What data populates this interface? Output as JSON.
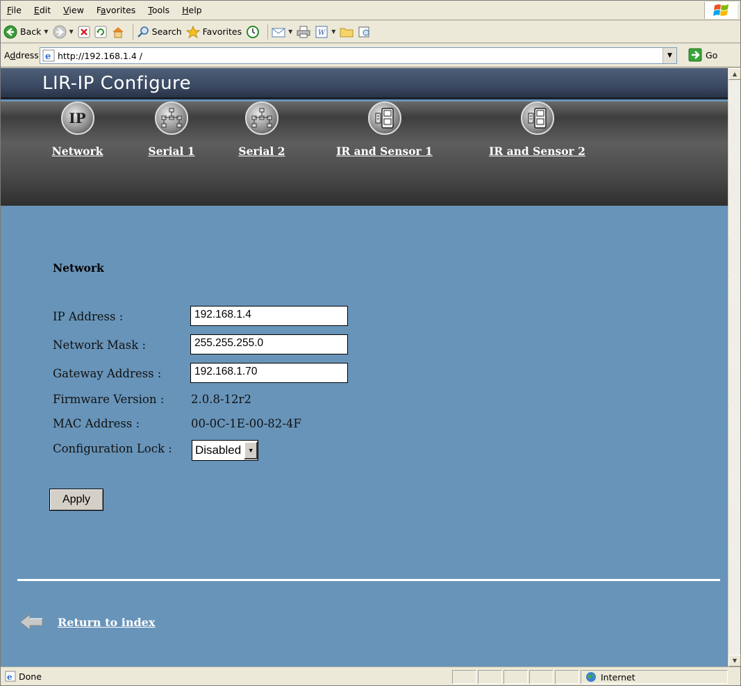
{
  "browser": {
    "menu": [
      "File",
      "Edit",
      "View",
      "Favorites",
      "Tools",
      "Help"
    ],
    "menu_accel": [
      "F",
      "E",
      "V",
      "a",
      "T",
      "H"
    ],
    "toolbar": {
      "back": "Back",
      "search": "Search",
      "favorites": "Favorites"
    },
    "address_label": "Address",
    "address_accel": "d",
    "url": "http://192.168.1.4 /",
    "go_label": "Go",
    "status_text": "Done",
    "zone": "Internet"
  },
  "page": {
    "title": "LIR-IP Configure",
    "nav": [
      {
        "label": "Network",
        "icon": "ip-icon"
      },
      {
        "label": "Serial 1",
        "icon": "network-icon"
      },
      {
        "label": "Serial 2",
        "icon": "network-icon"
      },
      {
        "label": "IR and Sensor 1",
        "icon": "device-icon"
      },
      {
        "label": "IR and Sensor 2",
        "icon": "device-icon"
      }
    ],
    "section_title": "Network",
    "fields": {
      "ip_label": "IP Address :",
      "ip_value": "192.168.1.4",
      "mask_label": "Network Mask :",
      "mask_value": "255.255.255.0",
      "gateway_label": "Gateway Address :",
      "gateway_value": "192.168.1.70",
      "firmware_label": "Firmware Version :",
      "firmware_value": "2.0.8-12r2",
      "mac_label": "MAC Address :",
      "mac_value": "00-0C-1E-00-82-4F",
      "lock_label": "Configuration Lock :",
      "lock_value": "Disabled"
    },
    "apply_label": "Apply",
    "return_label": "Return to index"
  }
}
